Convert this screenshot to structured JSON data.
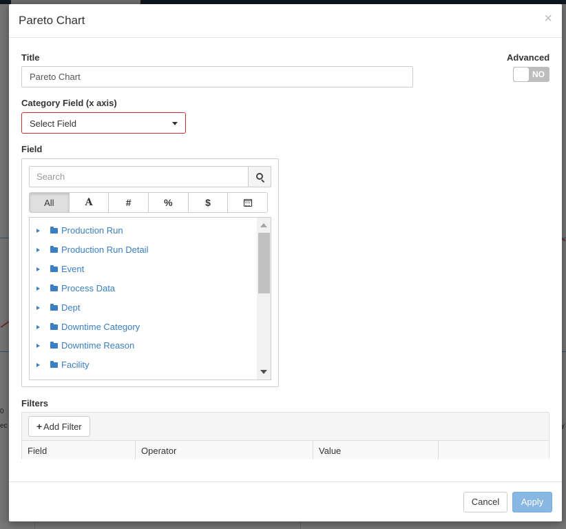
{
  "background": {
    "left_texts": [
      "0",
      "ec"
    ],
    "right_texts": [
      "y"
    ]
  },
  "modal": {
    "title": "Pareto Chart",
    "close_glyph": "×"
  },
  "form": {
    "title_label": "Title",
    "title_value": "Pareto Chart",
    "advanced_label": "Advanced",
    "advanced_toggle": "NO",
    "category_label": "Category Field (x axis)",
    "category_select": "Select Field",
    "field_label": "Field",
    "search_placeholder": "Search",
    "type_filters": [
      {
        "label": "All",
        "icon": null,
        "active": true
      },
      {
        "label": "A",
        "icon": "text-type-icon",
        "active": false
      },
      {
        "label": "#",
        "icon": "number-type-icon",
        "active": false
      },
      {
        "label": "%",
        "icon": "percent-type-icon",
        "active": false
      },
      {
        "label": "$",
        "icon": "currency-type-icon",
        "active": false
      },
      {
        "label": "",
        "icon": "calendar-icon",
        "active": false
      }
    ],
    "tree_items": [
      "Production Run",
      "Production Run Detail",
      "Event",
      "Process Data",
      "Dept",
      "Downtime Category",
      "Downtime Reason",
      "Facility"
    ],
    "filters_label": "Filters",
    "add_filter_plus": "+",
    "add_filter_label": "Add Filter",
    "filter_columns": [
      "Field",
      "Operator",
      "Value",
      ""
    ]
  },
  "footer": {
    "cancel_label": "Cancel",
    "apply_label": "Apply"
  },
  "colors": {
    "link_blue": "#3a7fc1",
    "error_border": "#c9302c",
    "apply_bg": "#87b7e2"
  }
}
